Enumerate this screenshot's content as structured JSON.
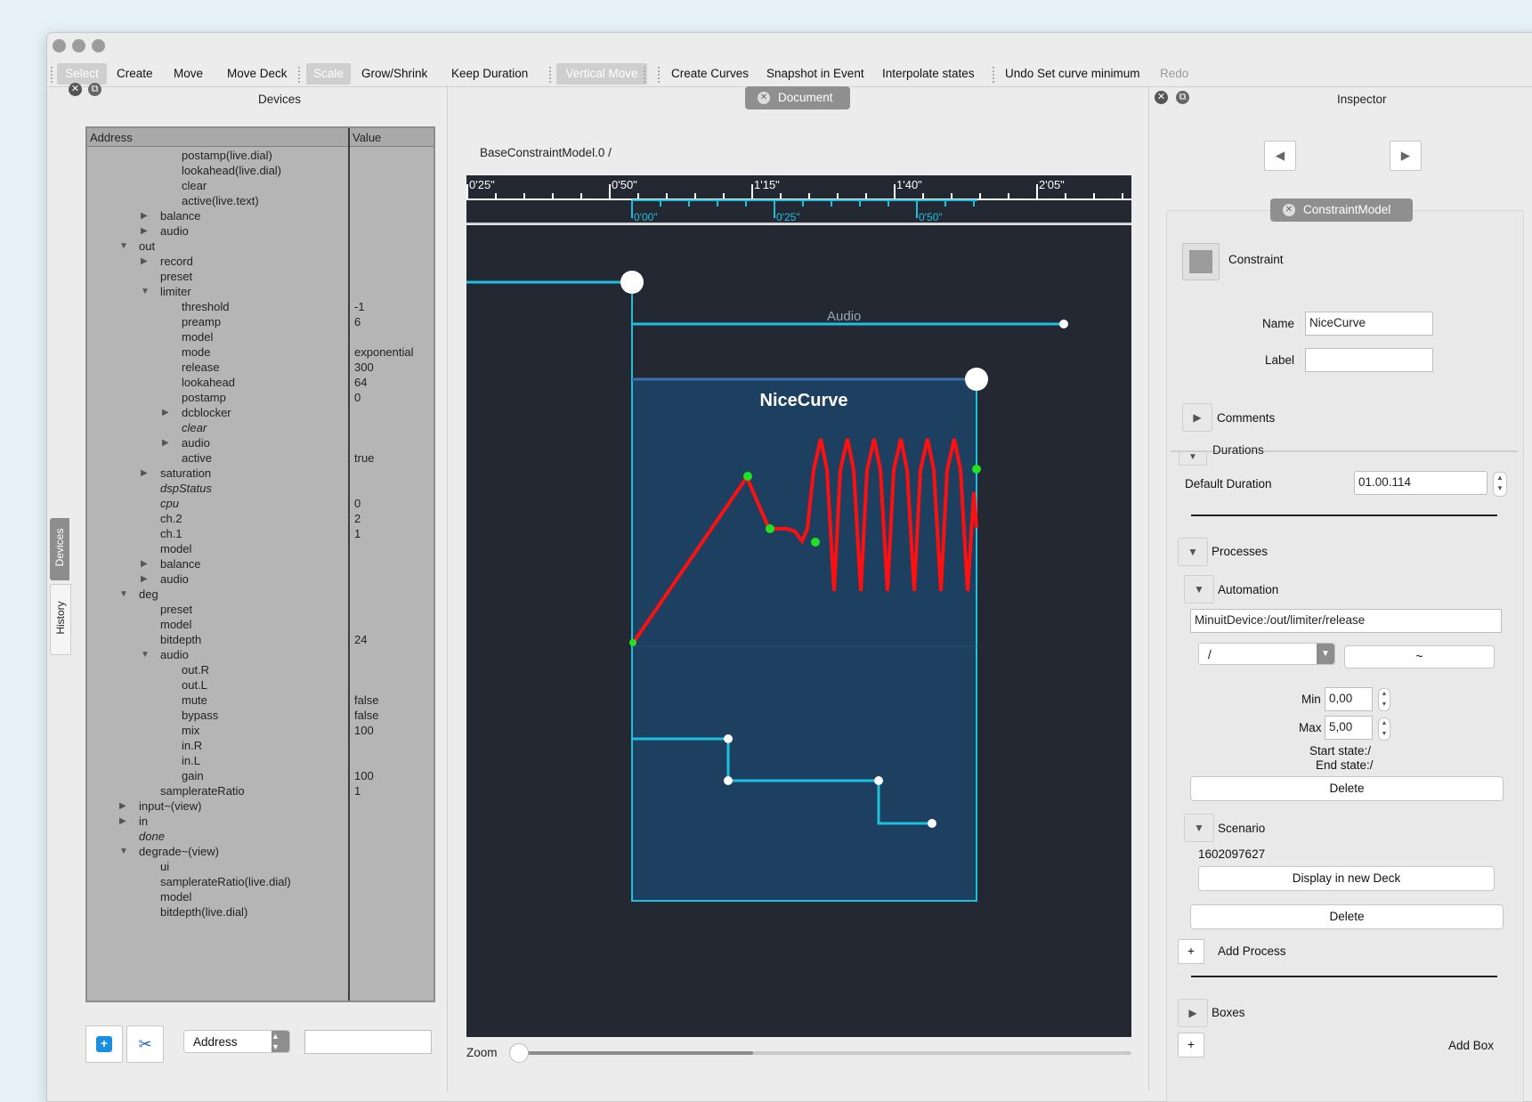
{
  "toolbar": {
    "items": [
      "Select",
      "Create",
      "Move",
      "Move Deck",
      "Scale",
      "Grow/Shrink",
      "Keep Duration",
      "Vertical Move",
      "Create Curves",
      "Snapshot in Event",
      "Interpolate states",
      "Undo Set curve minimum",
      "Redo"
    ]
  },
  "devices": {
    "title": "Devices",
    "col_address": "Address",
    "col_value": "Value",
    "rows": [
      {
        "name": "postamp(live.dial)",
        "value": "",
        "depth": 3,
        "arrow": "",
        "italic": false
      },
      {
        "name": "lookahead(live.dial)",
        "value": "",
        "depth": 3,
        "arrow": "",
        "italic": false
      },
      {
        "name": "clear",
        "value": "",
        "depth": 3,
        "arrow": "",
        "italic": false
      },
      {
        "name": "active(live.text)",
        "value": "",
        "depth": 3,
        "arrow": "",
        "italic": false
      },
      {
        "name": "balance",
        "value": "",
        "depth": 2,
        "arrow": "▶",
        "italic": false
      },
      {
        "name": "audio",
        "value": "",
        "depth": 2,
        "arrow": "▶",
        "italic": false
      },
      {
        "name": "out",
        "value": "",
        "depth": 1,
        "arrow": "▼",
        "italic": false
      },
      {
        "name": "record",
        "value": "",
        "depth": 2,
        "arrow": "▶",
        "italic": false
      },
      {
        "name": "preset",
        "value": "",
        "depth": 2,
        "arrow": "",
        "italic": false
      },
      {
        "name": "limiter",
        "value": "",
        "depth": 2,
        "arrow": "▼",
        "italic": false
      },
      {
        "name": "threshold",
        "value": "-1",
        "depth": 3,
        "arrow": "",
        "italic": false
      },
      {
        "name": "preamp",
        "value": "6",
        "depth": 3,
        "arrow": "",
        "italic": false
      },
      {
        "name": "model",
        "value": "",
        "depth": 3,
        "arrow": "",
        "italic": false
      },
      {
        "name": "mode",
        "value": "exponential",
        "depth": 3,
        "arrow": "",
        "italic": false
      },
      {
        "name": "release",
        "value": "300",
        "depth": 3,
        "arrow": "",
        "italic": false
      },
      {
        "name": "lookahead",
        "value": "64",
        "depth": 3,
        "arrow": "",
        "italic": false
      },
      {
        "name": "postamp",
        "value": "0",
        "depth": 3,
        "arrow": "",
        "italic": false
      },
      {
        "name": "dcblocker",
        "value": "",
        "depth": 3,
        "arrow": "▶",
        "italic": false
      },
      {
        "name": "clear",
        "value": "",
        "depth": 3,
        "arrow": "",
        "italic": true
      },
      {
        "name": "audio",
        "value": "",
        "depth": 3,
        "arrow": "▶",
        "italic": false
      },
      {
        "name": "active",
        "value": "true",
        "depth": 3,
        "arrow": "",
        "italic": false
      },
      {
        "name": "saturation",
        "value": "",
        "depth": 2,
        "arrow": "▶",
        "italic": false
      },
      {
        "name": "dspStatus",
        "value": "",
        "depth": 2,
        "arrow": "",
        "italic": true
      },
      {
        "name": "cpu",
        "value": "0",
        "depth": 2,
        "arrow": "",
        "italic": true
      },
      {
        "name": "ch.2",
        "value": "2",
        "depth": 2,
        "arrow": "",
        "italic": false
      },
      {
        "name": "ch.1",
        "value": "1",
        "depth": 2,
        "arrow": "",
        "italic": false
      },
      {
        "name": "model",
        "value": "",
        "depth": 2,
        "arrow": "",
        "italic": false
      },
      {
        "name": "balance",
        "value": "",
        "depth": 2,
        "arrow": "▶",
        "italic": false
      },
      {
        "name": "audio",
        "value": "",
        "depth": 2,
        "arrow": "▶",
        "italic": false
      },
      {
        "name": "deg",
        "value": "",
        "depth": 1,
        "arrow": "▼",
        "italic": false
      },
      {
        "name": "preset",
        "value": "",
        "depth": 2,
        "arrow": "",
        "italic": false
      },
      {
        "name": "model",
        "value": "",
        "depth": 2,
        "arrow": "",
        "italic": false
      },
      {
        "name": "bitdepth",
        "value": "24",
        "depth": 2,
        "arrow": "",
        "italic": false
      },
      {
        "name": "audio",
        "value": "",
        "depth": 2,
        "arrow": "▼",
        "italic": false
      },
      {
        "name": "out.R",
        "value": "",
        "depth": 3,
        "arrow": "",
        "italic": false
      },
      {
        "name": "out.L",
        "value": "",
        "depth": 3,
        "arrow": "",
        "italic": false
      },
      {
        "name": "mute",
        "value": "false",
        "depth": 3,
        "arrow": "",
        "italic": false
      },
      {
        "name": "bypass",
        "value": "false",
        "depth": 3,
        "arrow": "",
        "italic": false
      },
      {
        "name": "mix",
        "value": "100",
        "depth": 3,
        "arrow": "",
        "italic": false
      },
      {
        "name": "in.R",
        "value": "",
        "depth": 3,
        "arrow": "",
        "italic": false
      },
      {
        "name": "in.L",
        "value": "",
        "depth": 3,
        "arrow": "",
        "italic": false
      },
      {
        "name": "gain",
        "value": "100",
        "depth": 3,
        "arrow": "",
        "italic": false
      },
      {
        "name": "samplerateRatio",
        "value": "1",
        "depth": 2,
        "arrow": "",
        "italic": false
      },
      {
        "name": "input~(view)",
        "value": "",
        "depth": 1,
        "arrow": "▶",
        "italic": false
      },
      {
        "name": "in",
        "value": "",
        "depth": 1,
        "arrow": "▶",
        "italic": false
      },
      {
        "name": "done",
        "value": "",
        "depth": 1,
        "arrow": "",
        "italic": true
      },
      {
        "name": "degrade~(view)",
        "value": "",
        "depth": 1,
        "arrow": "▼",
        "italic": false
      },
      {
        "name": "ui",
        "value": "",
        "depth": 2,
        "arrow": "",
        "italic": false
      },
      {
        "name": "samplerateRatio(live.dial)",
        "value": "",
        "depth": 2,
        "arrow": "",
        "italic": false
      },
      {
        "name": "model",
        "value": "",
        "depth": 2,
        "arrow": "",
        "italic": false
      },
      {
        "name": "bitdepth(live.dial)",
        "value": "",
        "depth": 2,
        "arrow": "",
        "italic": false
      }
    ],
    "search_mode": "Address",
    "side_tabs": [
      "Devices",
      "History"
    ]
  },
  "document": {
    "tab": "Document",
    "path": "BaseConstraintModel.0   /",
    "ruler_top": [
      "0'25\"",
      "0'50\"",
      "1'15\"",
      "1'40\"",
      "2'05\""
    ],
    "ruler_bottom": [
      "0'00\"",
      "0'25\"",
      "0'50\""
    ],
    "audio_label": "Audio",
    "box_title": "NiceCurve",
    "zoom_label": "Zoom"
  },
  "inspector": {
    "title": "Inspector",
    "model_tab": "ConstraintModel",
    "constraint_label": "Constraint",
    "name_label": "Name",
    "name_value": "NiceCurve",
    "label_label": "Label",
    "label_value": "",
    "comments": "Comments",
    "durations": "Durations",
    "default_duration_label": "Default Duration",
    "default_duration_value": "01.00.114",
    "processes": "Processes",
    "automation": "Automation",
    "address_value": "MinuitDevice:/out/limiter/release",
    "combo_value": "/",
    "tilde": "~",
    "min_label": "Min",
    "min_value": "0,00",
    "max_label": "Max",
    "max_value": "5,00",
    "start_state": "Start state:/",
    "end_state": "End state:/",
    "delete1": "Delete",
    "scenario": "Scenario",
    "scenario_id": "1602097627",
    "display_new_deck": "Display in new Deck",
    "delete2": "Delete",
    "add_process": "Add Process",
    "boxes": "Boxes",
    "add_box": "Add Box",
    "plus": "+"
  },
  "colors": {
    "canvas_bg": "#232833",
    "cyan": "#1ec0e0",
    "box_bg": "#1d3f60",
    "curve_red": "#ff1010",
    "point_green": "#22e022"
  }
}
